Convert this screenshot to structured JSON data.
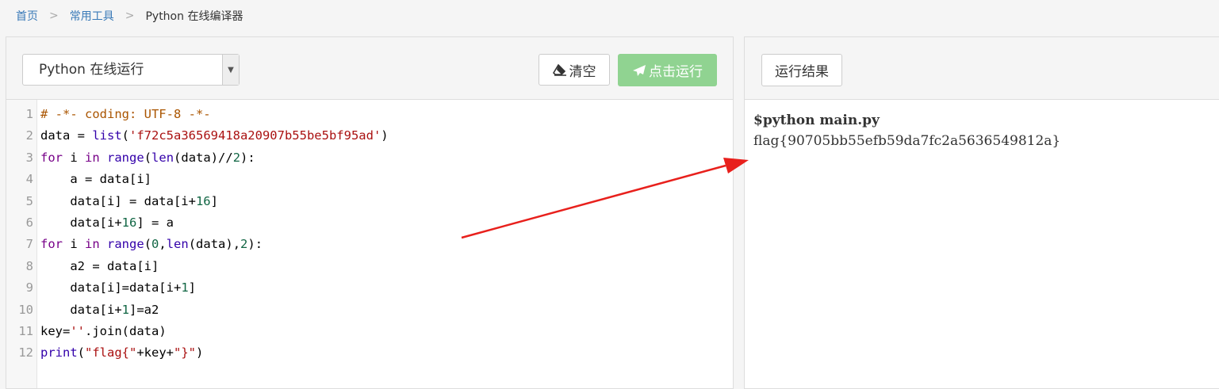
{
  "breadcrumb": {
    "home": "首页",
    "tools": "常用工具",
    "current": "Python 在线编译器",
    "sep": ">"
  },
  "toolbar": {
    "language": "Python 在线运行",
    "clear_label": "清空",
    "run_label": "点击运行",
    "clear_icon": "eraser-icon",
    "run_icon": "paper-plane-icon"
  },
  "output_panel": {
    "tab_label": "运行结果",
    "command": "$python main.py",
    "result": "flag{90705bb55efb59da7fc2a5636549812a}"
  },
  "code_lines": [
    "# -*- coding: UTF-8 -*-",
    "data = list('f72c5a36569418a20907b55be5bf95ad')",
    "for i in range(len(data)//2):",
    "    a = data[i]",
    "    data[i] = data[i+16]",
    "    data[i+16] = a",
    "for i in range(0,len(data),2):",
    "    a2 = data[i]",
    "    data[i]=data[i+1]",
    "    data[i+1]=a2",
    "key=''.join(data)",
    "print(\"flag{\"+key+\"}\")"
  ],
  "colors": {
    "run_button": "#90d391",
    "link": "#3a7ab8",
    "annotation_arrow": "#e8201c"
  }
}
